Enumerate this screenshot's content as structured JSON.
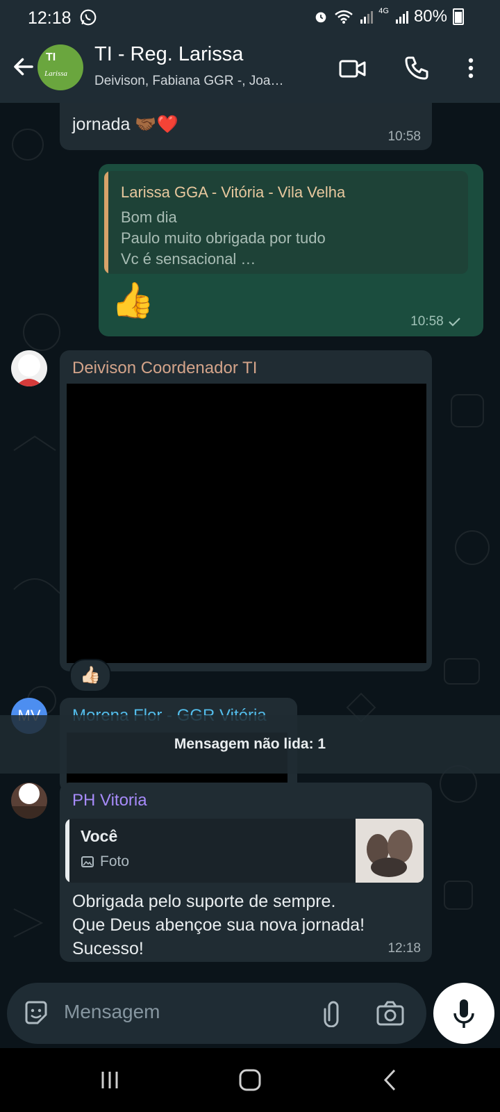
{
  "status_bar": {
    "time": "12:18",
    "lte": "4G",
    "battery": "80%"
  },
  "header": {
    "avatar_line1": "TI",
    "avatar_line2": "Larissa",
    "title": "TI - Reg. Larissa",
    "subtitle": "Deivison, Fabiana GGR -, Joa…"
  },
  "messages": {
    "m1": {
      "text": "jornada 🤝🏾❤️",
      "time": "10:58"
    },
    "m2": {
      "quote_author": "Larissa GGA - Vitória - Vila Velha",
      "quote_text": "Bom dia\nPaulo muito obrigada por tudo\nVc é sensacional …",
      "text": "👍",
      "time": "10:58"
    },
    "m3": {
      "sender": "Deivison Coordenador TI",
      "reaction": "👍🏻"
    },
    "m4": {
      "sender": "Morena Flor - GGR Vitória",
      "avatar_initials": "MV"
    },
    "unread": "Mensagem não lida: 1",
    "m5": {
      "sender": "PH Vitoria",
      "quote_author": "Você",
      "quote_type": "Foto",
      "text_line1": "Obrigada pelo suporte de sempre.",
      "text_line2": "Que Deus abençoe sua nova jornada!",
      "text_line3": "Sucesso!",
      "time": "12:18"
    }
  },
  "composer": {
    "placeholder": "Mensagem"
  },
  "colors": {
    "sender_deivison": "#d4a48a",
    "sender_morena": "#53bdeb",
    "sender_ph": "#a78bfa",
    "outgoing_bubble": "#1b4d3e",
    "incoming_bubble": "#202c33"
  }
}
